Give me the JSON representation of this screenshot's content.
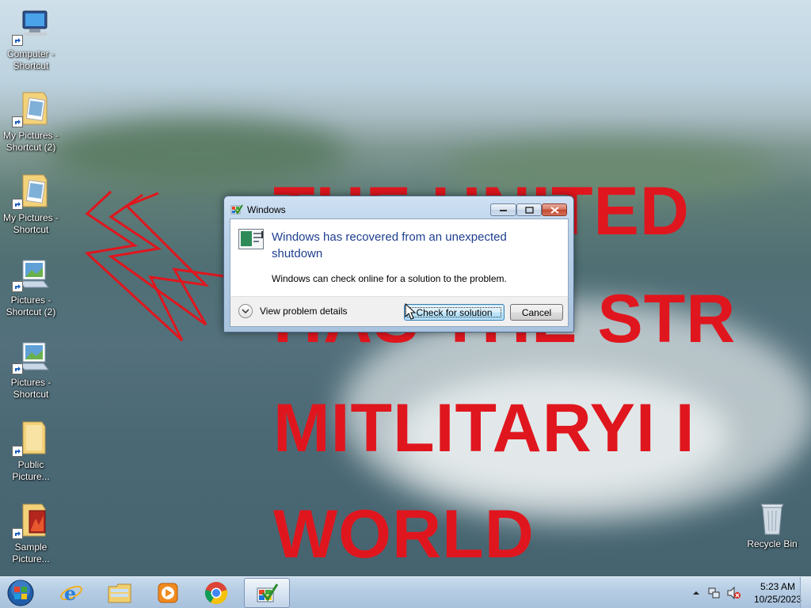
{
  "wallpaper": {
    "lines": [
      "THE UNITED",
      "HAS THE STR",
      "MITLITARYI I",
      "WORLD"
    ],
    "text_color": "#e0161e"
  },
  "desktop": {
    "icons": [
      {
        "label": "Computer - Shortcut",
        "icon": "computer-icon"
      },
      {
        "label": "My Pictures - Shortcut (2)",
        "icon": "pictures-folder-icon"
      },
      {
        "label": "My Pictures - Shortcut",
        "icon": "pictures-folder-icon"
      },
      {
        "label": "Pictures - Shortcut (2)",
        "icon": "pictures-library-icon"
      },
      {
        "label": "Pictures - Shortcut",
        "icon": "pictures-library-icon"
      },
      {
        "label": "Public Picture...",
        "icon": "folder-icon"
      },
      {
        "label": "Sample Picture...",
        "icon": "sample-pictures-folder-icon"
      }
    ],
    "recycle_bin": {
      "label": "Recycle Bin",
      "icon": "recycle-bin-icon"
    }
  },
  "dialog": {
    "title": "Windows",
    "main_instruction": "Windows has recovered from an unexpected shutdown",
    "content": "Windows can check online for a solution to the problem.",
    "details_label": "View problem details",
    "buttons": {
      "check": "Check for solution",
      "cancel": "Cancel"
    },
    "title_accent": "#1e3f8f"
  },
  "taskbar": {
    "pinned": [
      {
        "name": "internet-explorer",
        "icon": "internet-explorer-icon"
      },
      {
        "name": "windows-explorer",
        "icon": "windows-explorer-icon"
      },
      {
        "name": "windows-media-player",
        "icon": "media-player-icon"
      },
      {
        "name": "google-chrome",
        "icon": "chrome-icon"
      },
      {
        "name": "problem-reports",
        "icon": "action-center-icon",
        "active": true
      }
    ],
    "clock": {
      "time": "5:23 AM",
      "date": "10/25/2023"
    }
  }
}
